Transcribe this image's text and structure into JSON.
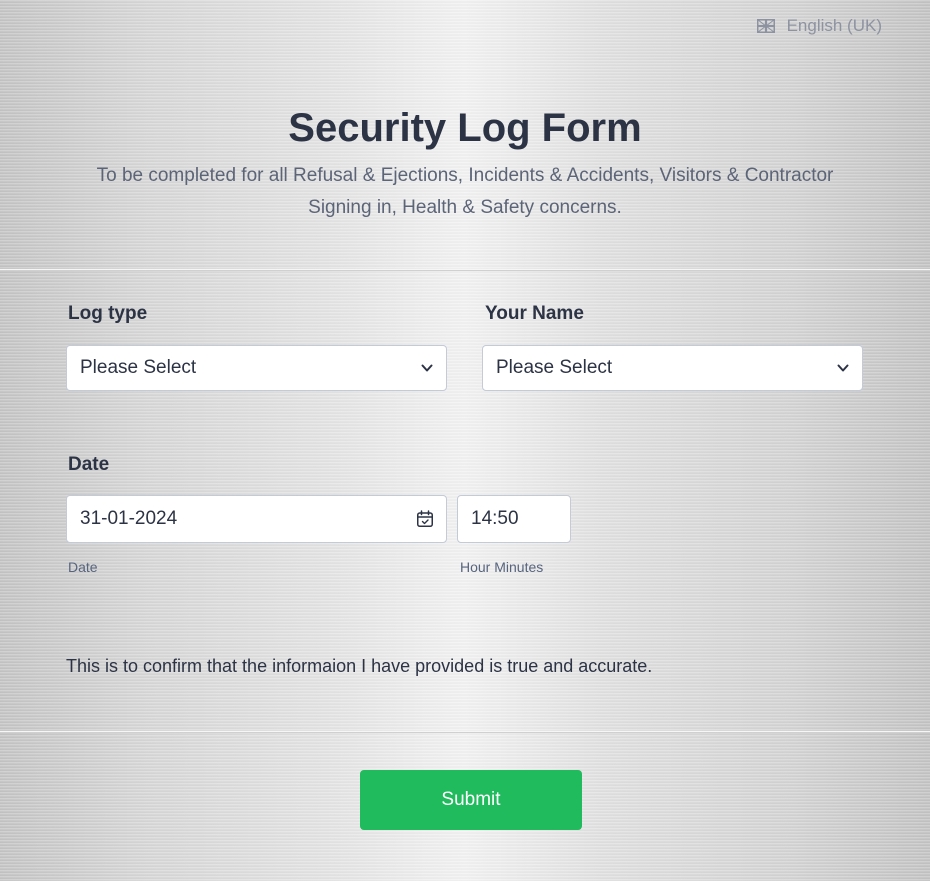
{
  "language": {
    "label": "English (UK)",
    "icon": "uk-flag-icon"
  },
  "header": {
    "title": "Security Log Form",
    "subtitle": "To be completed for all Refusal & Ejections, Incidents & Accidents, Visitors & Contractor Signing in, Health & Safety concerns."
  },
  "fields": {
    "log_type": {
      "label": "Log type",
      "value": "Please Select"
    },
    "your_name": {
      "label": "Your Name",
      "value": "Please Select"
    },
    "date": {
      "label": "Date",
      "date_value": "31-01-2024",
      "date_sublabel": "Date",
      "time_value": "14:50",
      "time_sublabel": "Hour Minutes"
    }
  },
  "confirmation_text": "This is to confirm that the informaion I have provided is true and accurate.",
  "submit_label": "Submit",
  "colors": {
    "submit": "#1fbb5d",
    "text": "#2c3345",
    "subtitle": "#5c6478"
  }
}
